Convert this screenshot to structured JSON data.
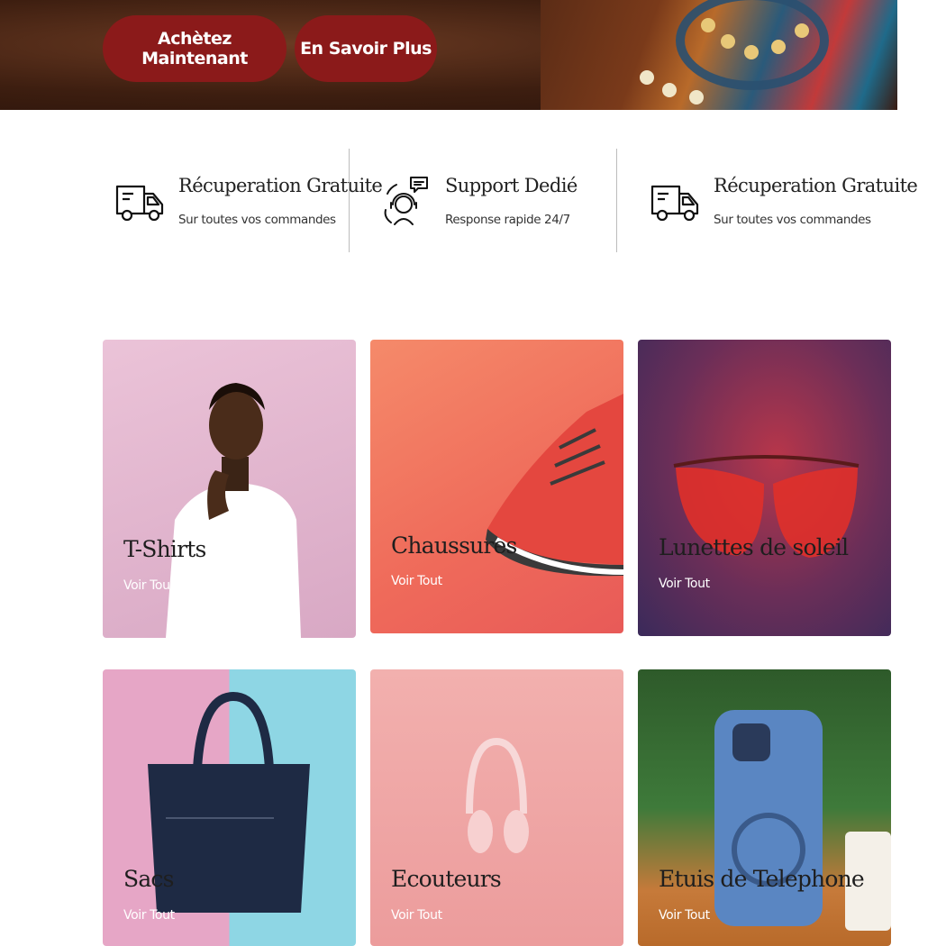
{
  "hero": {
    "buy_label": "Achètez Maintenant",
    "more_label": "En Savoir Plus",
    "accent": "#8b1a1a"
  },
  "features": [
    {
      "icon": "truck-icon",
      "title": "Récuperation Gratuite",
      "subtitle": "Sur toutes vos commandes"
    },
    {
      "icon": "support-agent-icon",
      "title": "Support Dedié",
      "subtitle": "Response rapide 24/7"
    },
    {
      "icon": "truck-icon",
      "title": "Récuperation Gratuite",
      "subtitle": "Sur toutes vos commandes"
    }
  ],
  "categories": [
    {
      "title": "T-Shirts",
      "link": "Voir Tout"
    },
    {
      "title": "Chaussures",
      "link": "Voir Tout"
    },
    {
      "title": "Lunettes de soleil",
      "link": "Voir Tout"
    },
    {
      "title": "Sacs",
      "link": "Voir Tout"
    },
    {
      "title": "Ecouteurs",
      "link": "Voir Tout"
    },
    {
      "title": "Etuis de Telephone",
      "link": "Voir Tout"
    }
  ]
}
